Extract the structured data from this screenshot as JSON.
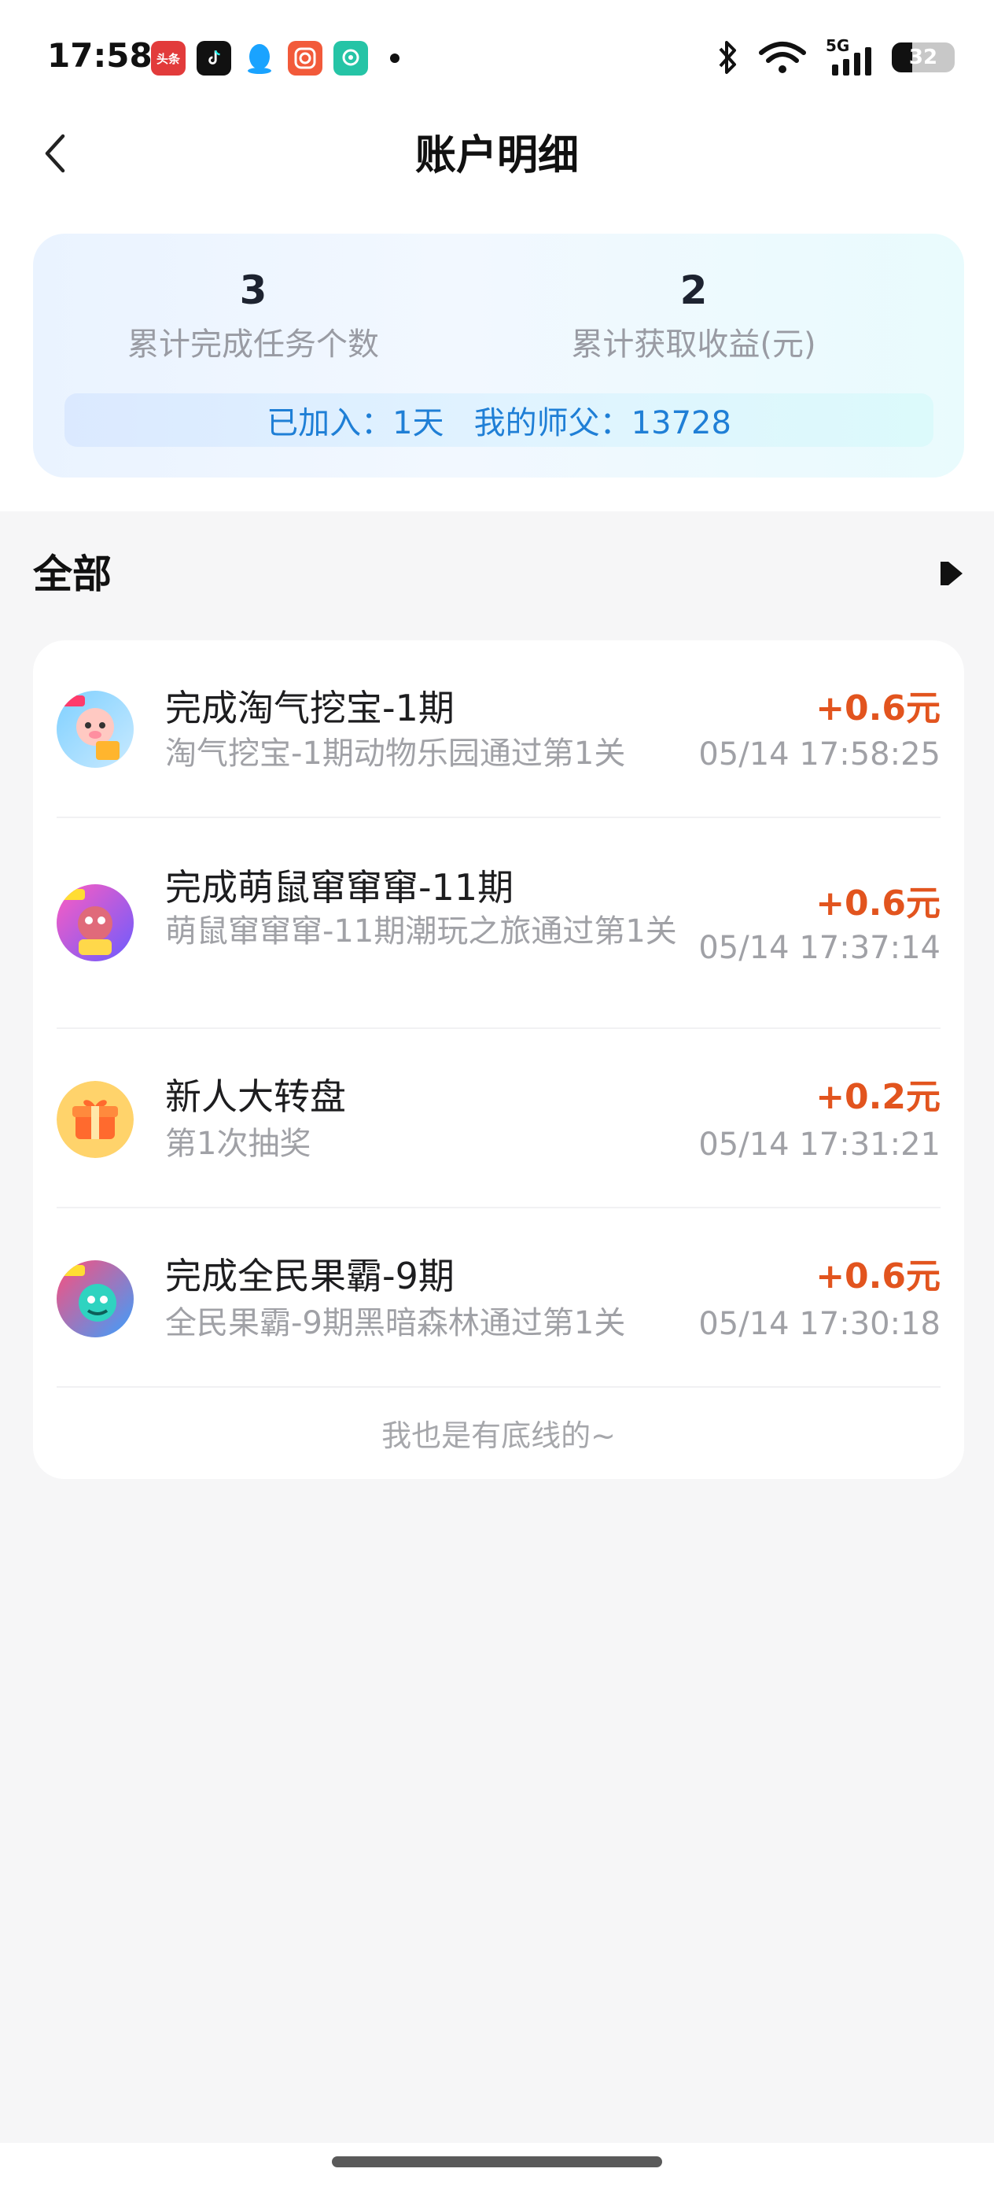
{
  "status_bar": {
    "time": "17:58",
    "notification_icons": [
      "toutiao-icon",
      "tiktok-icon",
      "qq-icon",
      "camera-app-icon",
      "chat-app-icon"
    ],
    "toutiao_label": "头条",
    "network": "5G",
    "battery": "32",
    "battery_level": 0.32
  },
  "header": {
    "title": "账户明细"
  },
  "summary": {
    "tasks_value": "3",
    "tasks_label": "累计完成任务个数",
    "earnings_value": "2",
    "earnings_label": "累计获取收益(元)",
    "info": "已加入：1天   我的师父：13728"
  },
  "section": {
    "title": "全部"
  },
  "records": [
    {
      "title": "完成淘气挖宝-1期",
      "desc": "淘气挖宝-1期动物乐园通过第1关",
      "amount": "+0.6元",
      "time": "05/14 17:58:25"
    },
    {
      "title": "完成萌鼠窜窜窜-11期",
      "desc": "萌鼠窜窜窜-11期潮玩之旅通过第1关",
      "amount": "+0.6元",
      "time": "05/14 17:37:14"
    },
    {
      "title": "新人大转盘",
      "desc": "第1次抽奖",
      "amount": "+0.2元",
      "time": "05/14 17:31:21"
    },
    {
      "title": "完成全民果霸-9期",
      "desc": "全民果霸-9期黑暗森林通过第1关",
      "amount": "+0.6元",
      "time": "05/14 17:30:18"
    }
  ],
  "footer_note": "我也是有底线的~",
  "colors": {
    "amount": "#e2541e",
    "info_text": "#1f7fd6",
    "muted_text": "#a0a1a6"
  }
}
